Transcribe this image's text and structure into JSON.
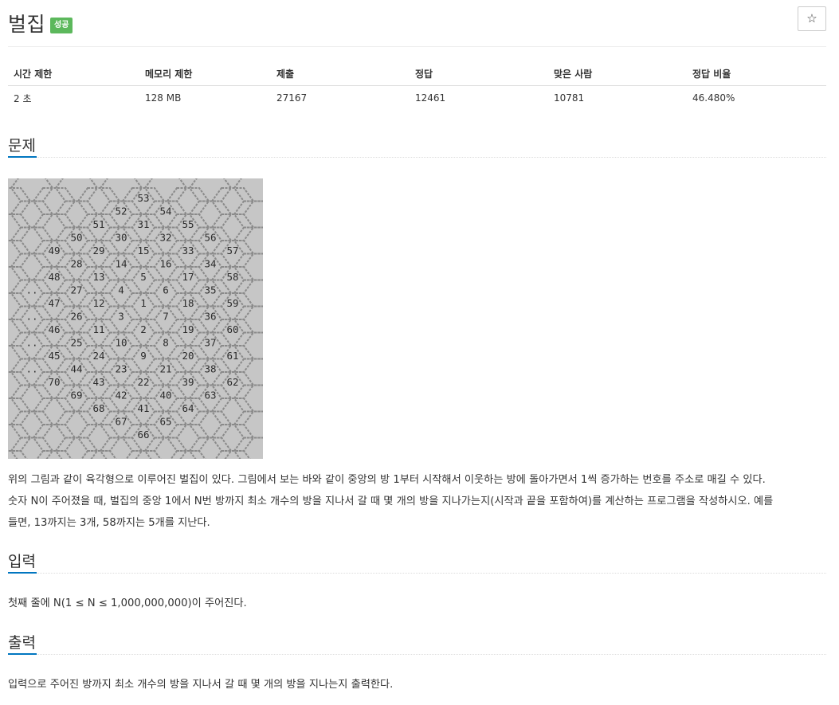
{
  "problem": {
    "title": "벌집",
    "badge": "성공",
    "star": "☆"
  },
  "stats": {
    "headers": [
      "시간 제한",
      "메모리 제한",
      "제출",
      "정답",
      "맞은 사람",
      "정답 비율"
    ],
    "values": [
      "2 초",
      "128 MB",
      "27167",
      "12461",
      "10781",
      "46.480%"
    ]
  },
  "sections": {
    "problem_heading": "문제",
    "description": [
      "위의 그림과 같이 육각형으로 이루어진 벌집이 있다. 그림에서 보는 바와 같이 중앙의 방 1부터 시작해서 이웃하는 방에 돌아가면서 1씩 증가하는 번호를 주소로 매길 수 있다.",
      "숫자 N이 주어졌을 때, 벌집의 중앙 1에서 N번 방까지 최소 개수의 방을 지나서 갈 때 몇 개의 방을 지나가는지(시작과 끝을 포함하여)를 계산하는 프로그램을 작성하시오. 예를",
      "들면, 13까지는 3개, 58까지는 5개를 지난다."
    ],
    "input_heading": "입력",
    "input_text": "첫째 줄에 N(1 ≤ N ≤ 1,000,000,000)이 주어진다.",
    "output_heading": "출력",
    "output_text": "입력으로 주어진 방까지 최소 개수의 방을 지나서 갈 때 몇 개의 방을 지나는지 출력한다."
  },
  "figure": {
    "labels": [
      [
        "53"
      ],
      [
        "52",
        "54"
      ],
      [
        "51",
        "31",
        "55"
      ],
      [
        "50",
        "30",
        "32",
        "56"
      ],
      [
        "49",
        "29",
        "15",
        "33",
        "57"
      ],
      [
        "28",
        "14",
        "16",
        "34"
      ],
      [
        "48",
        "13",
        "5",
        "17",
        "58"
      ],
      [
        "..",
        "27",
        "4",
        "6",
        "35"
      ],
      [
        "47",
        "12",
        "1",
        "18",
        "59"
      ],
      [
        "..",
        "26",
        "3",
        "7",
        "36"
      ],
      [
        "46",
        "11",
        "2",
        "19",
        "60"
      ],
      [
        "..",
        "25",
        "10",
        "8",
        "37"
      ],
      [
        "45",
        "24",
        "9",
        "20",
        "61"
      ],
      [
        "..",
        "44",
        "23",
        "21",
        "38"
      ],
      [
        "70",
        "43",
        "22",
        "39",
        "62"
      ],
      [
        "69",
        "42",
        "40",
        "63"
      ],
      [
        "68",
        "41",
        "64"
      ],
      [
        "67",
        "65"
      ],
      [
        "66"
      ]
    ]
  }
}
